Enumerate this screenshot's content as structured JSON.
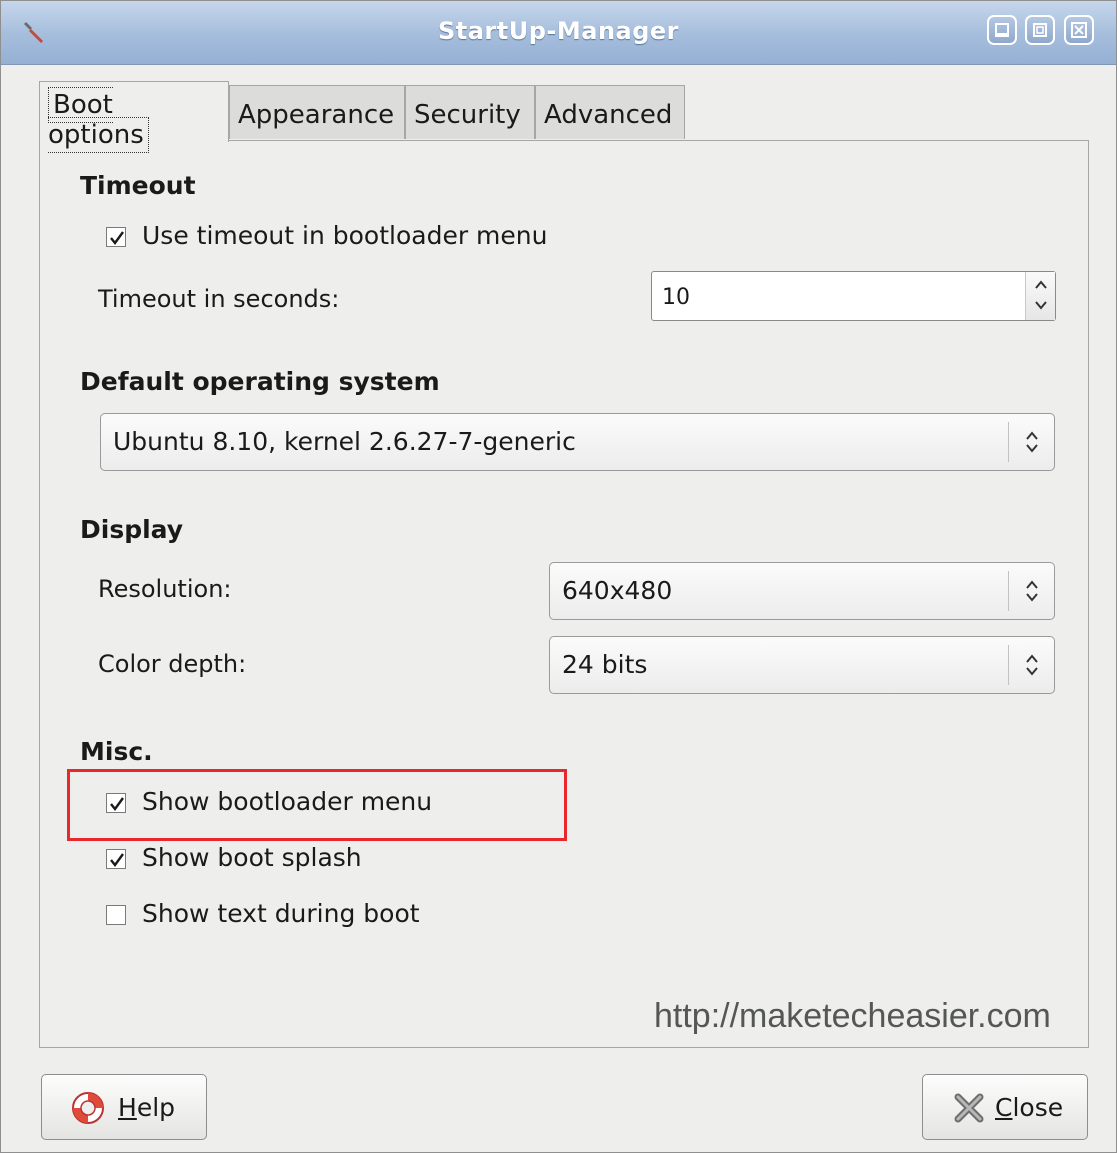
{
  "window": {
    "title": "StartUp-Manager",
    "icon": "wrench-icon"
  },
  "tabs": [
    {
      "label": "Boot options",
      "active": true
    },
    {
      "label": "Appearance",
      "active": false
    },
    {
      "label": "Security",
      "active": false
    },
    {
      "label": "Advanced",
      "active": false
    }
  ],
  "timeout": {
    "heading": "Timeout",
    "use_timeout_label": "Use timeout in bootloader menu",
    "use_timeout_checked": true,
    "seconds_label": "Timeout in seconds:",
    "seconds_value": "10"
  },
  "default_os": {
    "heading": "Default operating system",
    "selected": "Ubuntu 8.10, kernel 2.6.27-7-generic"
  },
  "display": {
    "heading": "Display",
    "resolution_label": "Resolution:",
    "resolution_value": "640x480",
    "color_depth_label": "Color depth:",
    "color_depth_value": "24 bits"
  },
  "misc": {
    "heading": "Misc.",
    "options": [
      {
        "label": "Show bootloader menu",
        "checked": true
      },
      {
        "label": "Show boot splash",
        "checked": true
      },
      {
        "label": "Show text during boot",
        "checked": false
      }
    ]
  },
  "watermark": "http://maketecheasier.com",
  "buttons": {
    "help_mnemonic": "H",
    "help_rest": "elp",
    "close_mnemonic": "C",
    "close_rest": "lose"
  },
  "colors": {
    "highlight": "#e8282d",
    "titlebar": "#a7bfdd"
  }
}
